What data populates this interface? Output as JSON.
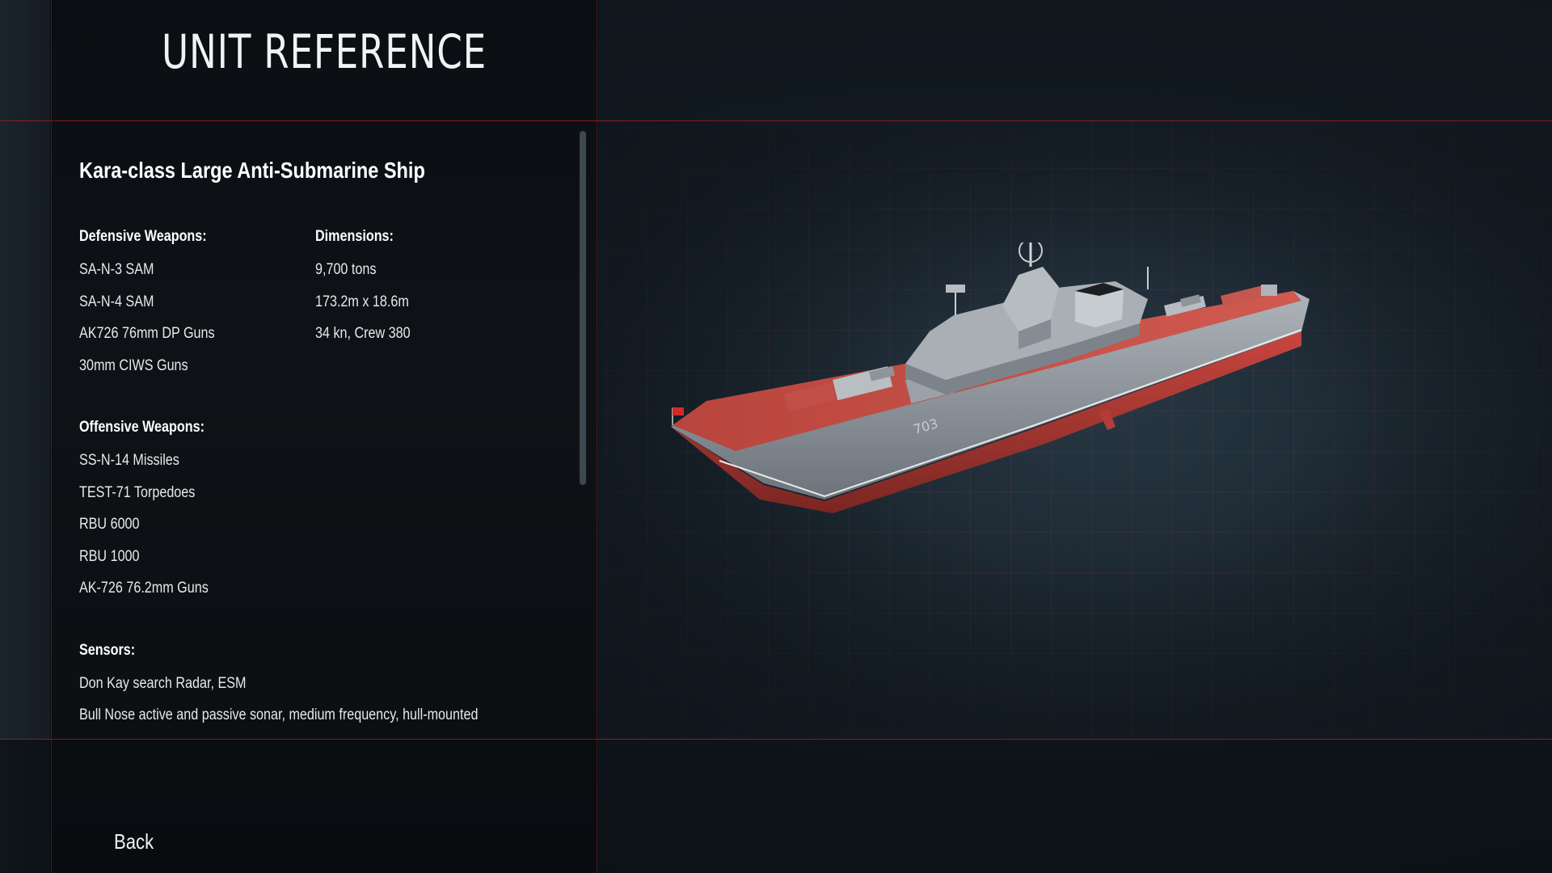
{
  "header": {
    "title": "UNIT REFERENCE"
  },
  "unit": {
    "name": "Kara-class Large Anti-Submarine Ship",
    "hull_number": "703",
    "defensive": {
      "title": "Defensive Weapons:",
      "items": [
        "SA-N-3 SAM",
        "SA-N-4 SAM",
        "AK726 76mm DP Guns",
        "30mm CIWS Guns"
      ]
    },
    "dimensions": {
      "title": "Dimensions:",
      "items": [
        "9,700 tons",
        "173.2m x 18.6m",
        "34 kn, Crew 380"
      ]
    },
    "offensive": {
      "title": "Offensive Weapons:",
      "items": [
        "SS-N-14 Missiles",
        "TEST-71 Torpedoes",
        "RBU 6000",
        "RBU 1000",
        "AK-726 76.2mm Guns"
      ]
    },
    "sensors": {
      "title": "Sensors:",
      "items": [
        "Don Kay search Radar, ESM",
        "Bull Nose active and passive sonar, medium frequency, hull-mounted"
      ]
    }
  },
  "footer": {
    "back_label": "Back"
  },
  "colors": {
    "accent_red": "#aa1e23",
    "hull_red": "#c9463f",
    "hull_gray": "#8e959c",
    "panel_dark": "#0b0e12"
  },
  "icons": {
    "viewer": "ship-model-render",
    "flag": "naval-ensign-flag-icon"
  }
}
